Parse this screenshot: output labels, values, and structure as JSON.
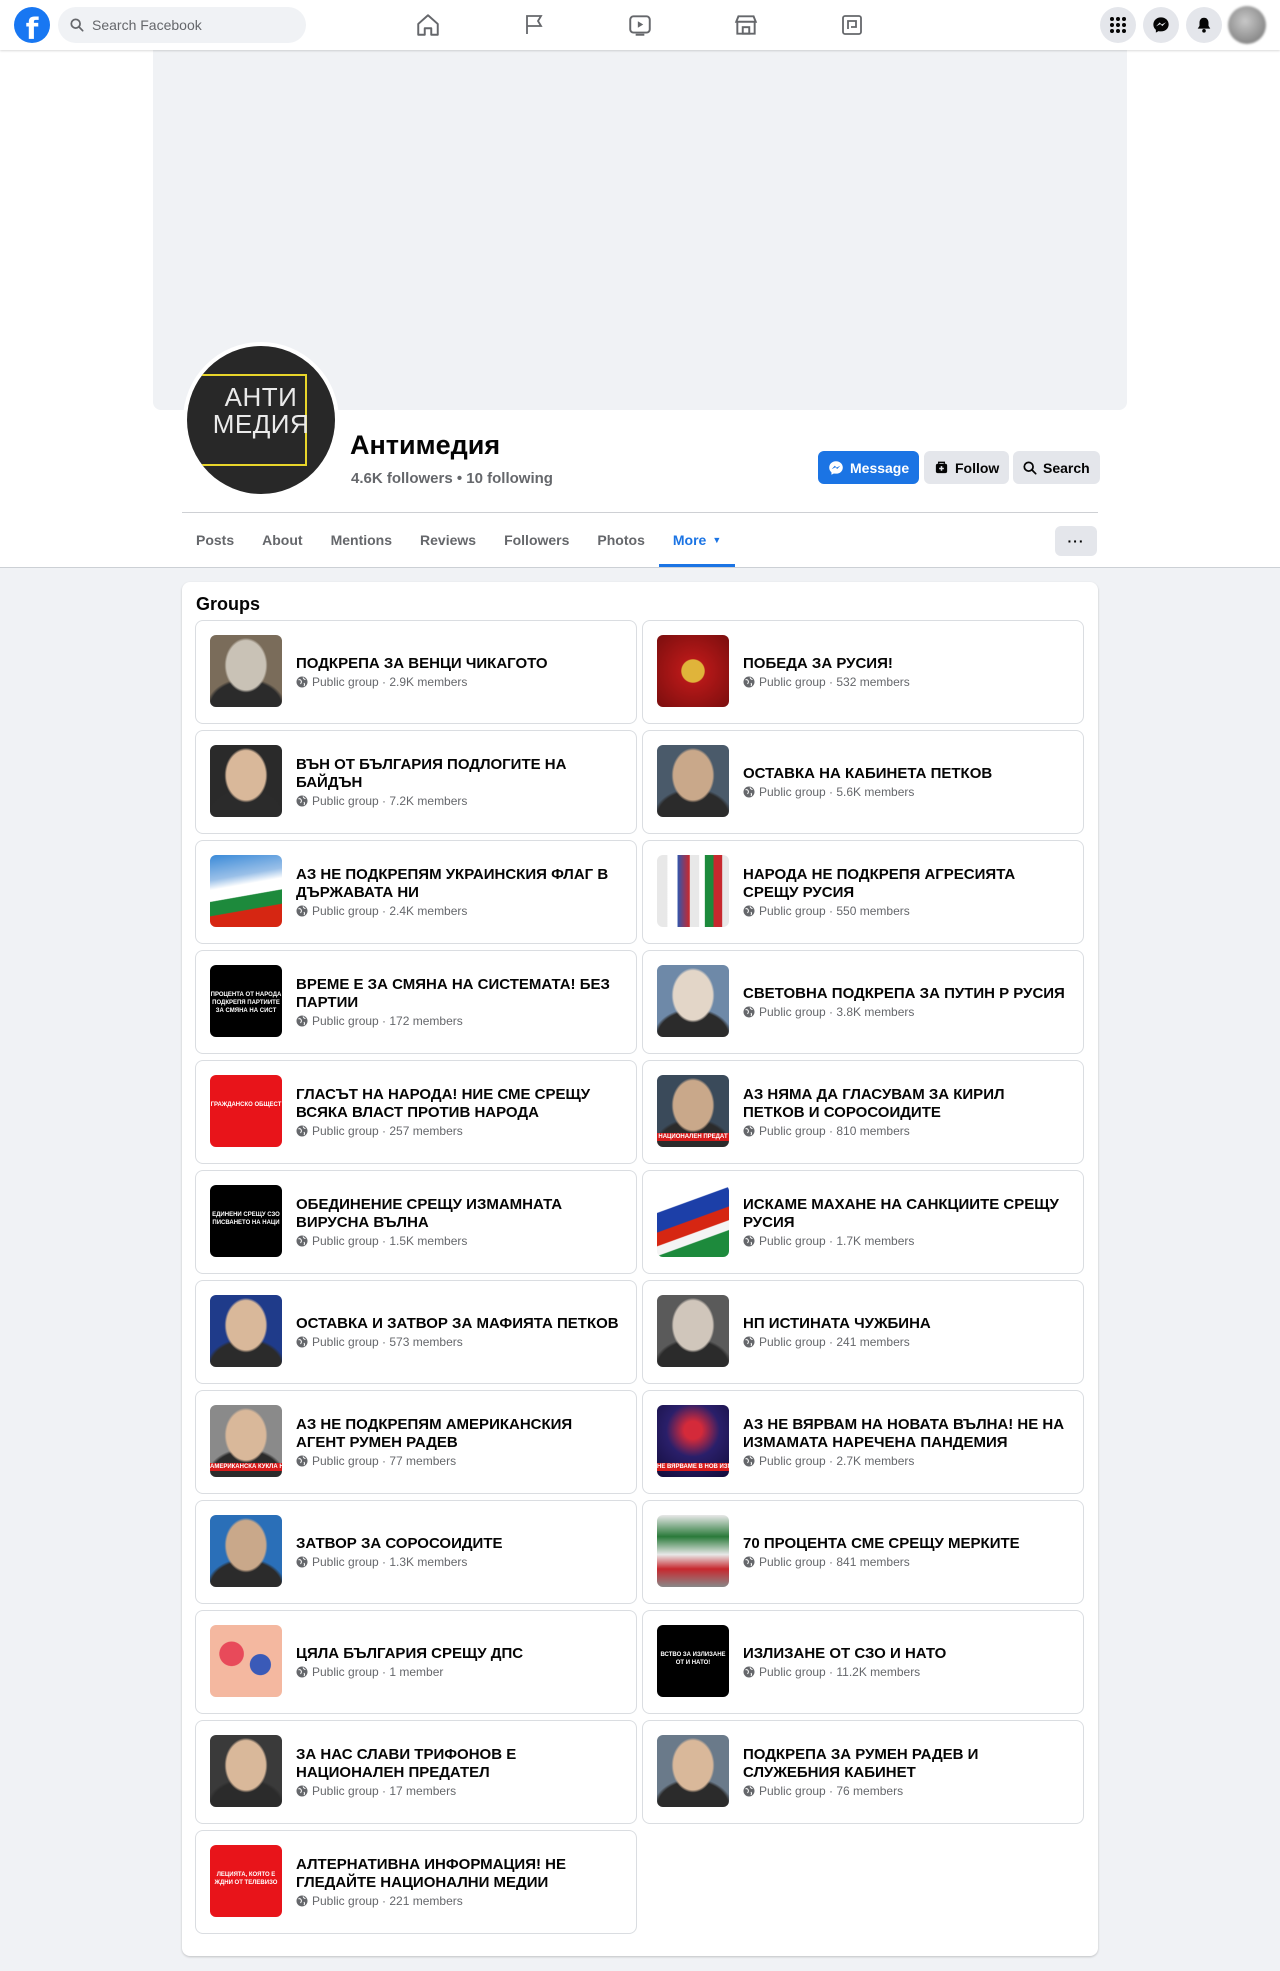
{
  "topbar": {
    "search_placeholder": "Search Facebook",
    "logo_letter": "f",
    "nav_icons": [
      "home-icon",
      "pages-flag-icon",
      "watch-icon",
      "marketplace-icon",
      "gaming-icon"
    ],
    "right_icons": [
      "menu-grid-icon",
      "messenger-icon",
      "notifications-bell-icon"
    ]
  },
  "profile": {
    "avatar_text_line1": "АНТИ",
    "avatar_text_line2": "МЕДИЯ",
    "name": "Антимедия",
    "stats": "4.6K followers • 10 following",
    "buttons": {
      "message": "Message",
      "follow": "Follow",
      "search": "Search"
    }
  },
  "tabs": [
    {
      "label": "Posts"
    },
    {
      "label": "About"
    },
    {
      "label": "Mentions"
    },
    {
      "label": "Reviews"
    },
    {
      "label": "Followers"
    },
    {
      "label": "Photos"
    },
    {
      "label": "More",
      "active": true
    }
  ],
  "more_dots": "···",
  "groups_section": {
    "title": "Groups",
    "groups": [
      {
        "name": "ПОДКРЕПА ЗА ВЕНЦИ ЧИКАГОТО",
        "meta": "Public group · 2.9K members",
        "thumb": "photo-man",
        "colors": [
          "#7a6c5a",
          "#c9c2b6"
        ]
      },
      {
        "name": "ПОБЕДА ЗА РУСИЯ!",
        "meta": "Public group · 532 members",
        "thumb": "coat-of-arms",
        "colors": [
          "#b51818",
          "#e0b43a"
        ]
      },
      {
        "name": "ВЪН ОТ БЪЛГАРИЯ ПОДЛОГИТЕ НА БАЙДЪН",
        "meta": "Public group · 7.2K members",
        "thumb": "photo-man",
        "colors": [
          "#2a2a2a",
          "#d9b89a"
        ]
      },
      {
        "name": "ОСТАВКА НА КАБИНЕТА ПЕТКОВ",
        "meta": "Public group · 5.6K members",
        "thumb": "photo-man",
        "colors": [
          "#4a5a6a",
          "#c9a88a"
        ]
      },
      {
        "name": "АЗ НЕ ПОДКРЕПЯМ УКРАИНСКИЯ ФЛАГ В ДЪРЖАВАТА НИ",
        "meta": "Public group · 2.4K members",
        "thumb": "bg-flag",
        "colors": [
          "#ffffff",
          "#1d8a3c",
          "#d62612"
        ]
      },
      {
        "name": "НАРОДА НЕ ПОДКРЕПЯ АГРЕСИЯТА СРЕЩУ РУСИЯ",
        "meta": "Public group · 550 members",
        "thumb": "two-flags",
        "colors": [
          "#e8e8e8",
          "#1d8a3c",
          "#c7282e"
        ]
      },
      {
        "name": "ВРЕМЕ Е ЗА СМЯНА НА СИСТЕМАТА! БЕЗ ПАРТИИ",
        "meta": "Public group · 172 members",
        "thumb": "text-black",
        "colors": [
          "#000000"
        ],
        "thumb_text": "ПРОЦЕНТА ОТ НАРОДА ПОДКРЕПЯ ПАРТИИТЕ ЗА СМЯНА НА СИСТ"
      },
      {
        "name": "СВЕТОВНА ПОДКРЕПА ЗА ПУТИН Р РУСИЯ",
        "meta": "Public group · 3.8K members",
        "thumb": "photo-man",
        "colors": [
          "#6e89a8",
          "#e3d6c8"
        ]
      },
      {
        "name": "ГЛАСЪТ НА НАРОДА! НИЕ СМЕ СРЕЩУ ВСЯКА ВЛАСТ ПРОТИВ НАРОДА",
        "meta": "Public group · 257 members",
        "thumb": "text-red",
        "colors": [
          "#e8141a"
        ],
        "thumb_text": "ГРАЖДАНСКО ОБЩЕСТ"
      },
      {
        "name": "АЗ НЯМА ДА ГЛАСУВАМ ЗА КИРИЛ ПЕТКОВ И СОРОСОИДИТЕ",
        "meta": "Public group · 810 members",
        "thumb": "photo-man",
        "colors": [
          "#3a4a5a",
          "#c9a88a"
        ],
        "thumb_text": "НАЦИОНАЛЕН ПРЕДАТ"
      },
      {
        "name": "ОБЕДИНЕНИЕ СРЕЩУ ИЗМАМНАТА ВИРУСНА ВЪЛНА",
        "meta": "Public group · 1.5K members",
        "thumb": "text-black",
        "colors": [
          "#000000"
        ],
        "thumb_text": "ЕДИНЕНИ СРЕЩУ СЗО ПИСВАНЕТО НА НАЦИ"
      },
      {
        "name": "ИСКАМЕ МАХАНЕ НА САНКЦИИТЕ СРЕЩУ РУСИЯ",
        "meta": "Public group · 1.7K members",
        "thumb": "ru-bg-flag",
        "colors": [
          "#ffffff",
          "#1c3fa8",
          "#d62612",
          "#1d8a3c"
        ]
      },
      {
        "name": "ОСТАВКА И ЗАТВОР ЗА МАФИЯТА ПЕТКОВ",
        "meta": "Public group · 573 members",
        "thumb": "photo-man",
        "colors": [
          "#1f3b8a",
          "#d9b89a"
        ]
      },
      {
        "name": "НП ИСТИНАТА ЧУЖБИНА",
        "meta": "Public group · 241 members",
        "thumb": "photo-man",
        "colors": [
          "#5a5a5a",
          "#d0c6bb"
        ]
      },
      {
        "name": "АЗ НЕ ПОДКРЕПЯМ АМЕРИКАНСКИЯ АГЕНТ РУМЕН РАДЕВ",
        "meta": "Public group · 77 members",
        "thumb": "photo-man",
        "colors": [
          "#8a8a8a",
          "#d9b89a"
        ],
        "thumb_text": "АМЕРИКАНСКА КУКЛА НА"
      },
      {
        "name": "АЗ НЕ ВЯРВАМ НА НОВАТА ВЪЛНА! НЕ НА ИЗМАМАТА НАРЕЧЕНА ПАНДЕМИЯ",
        "meta": "Public group · 2.7K members",
        "thumb": "virus",
        "colors": [
          "#2a1f6a",
          "#d42a3a"
        ],
        "thumb_text": "НЕ ВЯРВАМЕ В НОВ ИЗМАМА!"
      },
      {
        "name": "ЗАТВОР ЗА СОРОСОИДИТЕ",
        "meta": "Public group · 1.3K members",
        "thumb": "photo-man",
        "colors": [
          "#2a6fb8",
          "#c9a88a"
        ]
      },
      {
        "name": "70 ПРОЦЕНТА СМЕ СРЕЩУ МЕРКИТЕ",
        "meta": "Public group · 841 members",
        "thumb": "protest-sign",
        "colors": [
          "#e8e8e8",
          "#2a7a3a",
          "#c7282e"
        ]
      },
      {
        "name": "ЦЯЛА БЪЛГАРИЯ СРЕЩУ ДПС",
        "meta": "Public group · 1 member",
        "thumb": "illustration",
        "colors": [
          "#f4b8a0",
          "#3a5ab8",
          "#e84a5a"
        ]
      },
      {
        "name": "ИЗЛИЗАНЕ ОТ СЗО И НАТО",
        "meta": "Public group · 11.2K members",
        "thumb": "text-black",
        "colors": [
          "#000000"
        ],
        "thumb_text": "ВСТВО ЗА ИЗЛИЗАНЕ ОТ И НАТО!"
      },
      {
        "name": "ЗА НАС СЛАВИ ТРИФОНОВ Е НАЦИОНАЛЕН ПРЕДАТЕЛ",
        "meta": "Public group · 17 members",
        "thumb": "photo-man",
        "colors": [
          "#3a3a3a",
          "#d9b89a"
        ]
      },
      {
        "name": "ПОДКРЕПА ЗА РУМЕН РАДЕВ И СЛУЖЕБНИЯ КАБИНЕТ",
        "meta": "Public group · 76 members",
        "thumb": "photo-man",
        "colors": [
          "#6a7a8a",
          "#d9b89a"
        ]
      },
      {
        "name": "АЛТЕРНАТИВНА ИНФОРМАЦИЯ! НЕ ГЛЕДАЙТЕ НАЦИОНАЛНИ МЕДИИ",
        "meta": "Public group · 221 members",
        "thumb": "text-red",
        "colors": [
          "#e8141a"
        ],
        "thumb_text": "ЛЕЦИЯТА, КОЯТО Е ЖДНИ ОТ ТЕЛЕВИЗО"
      }
    ]
  }
}
